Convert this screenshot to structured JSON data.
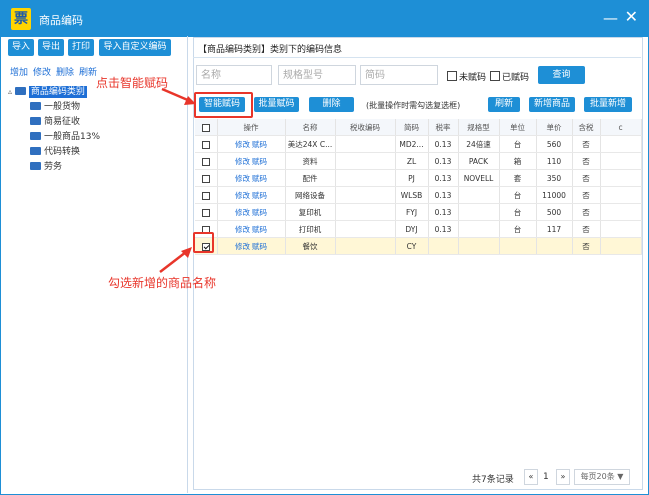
{
  "window": {
    "title": "商品编码",
    "app_icon": "票",
    "minimize_icon": "—",
    "close_icon": "✕"
  },
  "left_toolbar": {
    "import": "导入",
    "export": "导出",
    "print": "打印",
    "import_custom": "导入自定义编码"
  },
  "left_actions": {
    "add": "增加",
    "edit": "修改",
    "delete": "删除",
    "refresh": "刷新"
  },
  "tree": {
    "root": "商品编码类别",
    "children": [
      "一般货物",
      "简易征收",
      "一般商品13%",
      "代码转换",
      "劳务"
    ]
  },
  "header_label": "【商品编码类别】类别下的编码信息",
  "filters": {
    "name_placeholder": "名称",
    "spec_placeholder": "规格型号",
    "short_code_placeholder": "简码",
    "unassigned_label": "未赋码",
    "assigned_label": "已赋码",
    "query_button": "查询"
  },
  "actions": {
    "smart_assign": "智能赋码",
    "batch_assign": "批量赋码",
    "delete": "删除",
    "hint": "(批量操作时需勾选复选框)",
    "refresh": "刷新",
    "add_product": "新增商品",
    "batch_add": "批量新增"
  },
  "table": {
    "columns": [
      "",
      "操作",
      "名称",
      "税收编码",
      "简码",
      "税率",
      "规格型",
      "单位",
      "单价",
      "含税",
      "c"
    ],
    "row_actions": {
      "edit": "修改",
      "assign": "赋码"
    },
    "rows": [
      {
        "checked": false,
        "name": "美达24X C...",
        "tax_code": "",
        "short_code": "MD2...",
        "rate": "0.13",
        "spec": "24倍速",
        "unit": "台",
        "price": "560",
        "tax_included": "否"
      },
      {
        "checked": false,
        "name": "资料",
        "tax_code": "",
        "short_code": "ZL",
        "rate": "0.13",
        "spec": "PACK",
        "unit": "箱",
        "price": "110",
        "tax_included": "否"
      },
      {
        "checked": false,
        "name": "配件",
        "tax_code": "",
        "short_code": "PJ",
        "rate": "0.13",
        "spec": "NOVELL",
        "unit": "套",
        "price": "350",
        "tax_included": "否"
      },
      {
        "checked": false,
        "name": "网络设备",
        "tax_code": "",
        "short_code": "WLSB",
        "rate": "0.13",
        "spec": "",
        "unit": "台",
        "price": "11000",
        "tax_included": "否"
      },
      {
        "checked": false,
        "name": "复印机",
        "tax_code": "",
        "short_code": "FYJ",
        "rate": "0.13",
        "spec": "",
        "unit": "台",
        "price": "500",
        "tax_included": "否"
      },
      {
        "checked": false,
        "name": "打印机",
        "tax_code": "",
        "short_code": "DYJ",
        "rate": "0.13",
        "spec": "",
        "unit": "台",
        "price": "117",
        "tax_included": "否"
      },
      {
        "checked": true,
        "name": "餐饮",
        "tax_code": "",
        "short_code": "CY",
        "rate": "",
        "spec": "",
        "unit": "",
        "price": "",
        "tax_included": "否"
      }
    ]
  },
  "annotations": {
    "click_smart_assign": "点击智能赋码",
    "check_new_product": "勾选新增的商品名称"
  },
  "pager": {
    "total": "共7条记录",
    "prev": "«",
    "page": "1",
    "next": "»",
    "per_page": "每页20条 ▼"
  },
  "colors": {
    "primary": "#1e8fd6",
    "annotation": "#e8352a",
    "highlight_row": "#fff7d6"
  }
}
